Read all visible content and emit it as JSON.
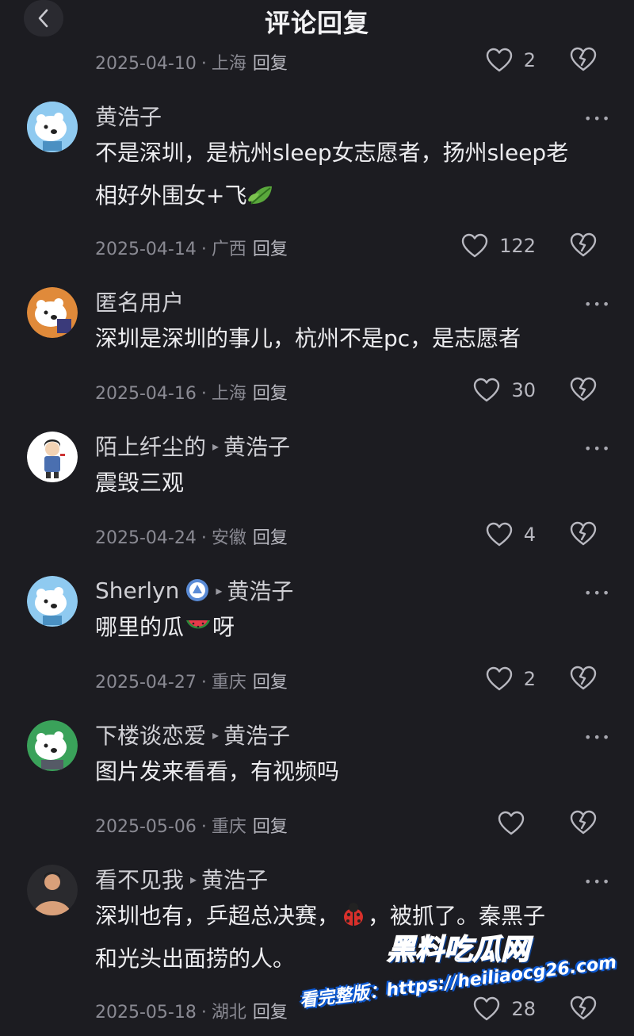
{
  "header": {
    "title": "评论回复"
  },
  "top_meta": {
    "date": "2025-04-10",
    "location": "上海",
    "reply_label": "回复",
    "likes": "2"
  },
  "comments": [
    {
      "name": "黄浩子",
      "reply_to": "",
      "content_lines": [
        "不是深圳，是杭州sleep女志愿者，扬州sleep老",
        "相好外围女+飞"
      ],
      "date": "2025-04-14",
      "location": "广西",
      "reply_label": "回复",
      "likes": "122"
    },
    {
      "name": "匿名用户",
      "reply_to": "",
      "content_lines": [
        "深圳是深圳的事儿，杭州不是pc，是志愿者"
      ],
      "date": "2025-04-16",
      "location": "上海",
      "reply_label": "回复",
      "likes": "30"
    },
    {
      "name": "陌上纤尘的",
      "reply_to": "黄浩子",
      "content_lines": [
        "震毁三观"
      ],
      "date": "2025-04-24",
      "location": "安徽",
      "reply_label": "回复",
      "likes": "4"
    },
    {
      "name": "Sherlyn",
      "reply_to": "黄浩子",
      "content_before": "哪里的瓜",
      "content_after": "呀",
      "date": "2025-04-27",
      "location": "重庆",
      "reply_label": "回复",
      "likes": "2"
    },
    {
      "name": "下楼谈恋爱",
      "reply_to": "黄浩子",
      "content_lines": [
        "图片发来看看，有视频吗"
      ],
      "date": "2025-05-06",
      "location": "重庆",
      "reply_label": "回复",
      "likes": ""
    },
    {
      "name": "看不见我",
      "reply_to": "黄浩子",
      "content_line1_before": "深圳也有，乒超总决赛，",
      "content_line1_after": "，被抓了。秦黑子",
      "content_line2": "和光头出面捞的人。",
      "date": "2025-05-18",
      "location": "湖北",
      "reply_label": "回复",
      "likes": "28"
    }
  ],
  "watermark": {
    "logo": "黑料吃瓜网",
    "prefix": "看完整版：",
    "url": "https://heiliaocg26.com"
  },
  "colors": {
    "background": "#1c1c21",
    "text": "#ececef",
    "meta": "#8a8a93",
    "watermark": "#4aa3ff"
  },
  "icons": [
    "back-chevron-icon",
    "heart-icon",
    "broken-heart-icon",
    "more-dots-icon",
    "reply-arrow-icon",
    "vip-badge-icon",
    "leaf-emoji",
    "watermelon-emoji",
    "ladybug-emoji"
  ]
}
